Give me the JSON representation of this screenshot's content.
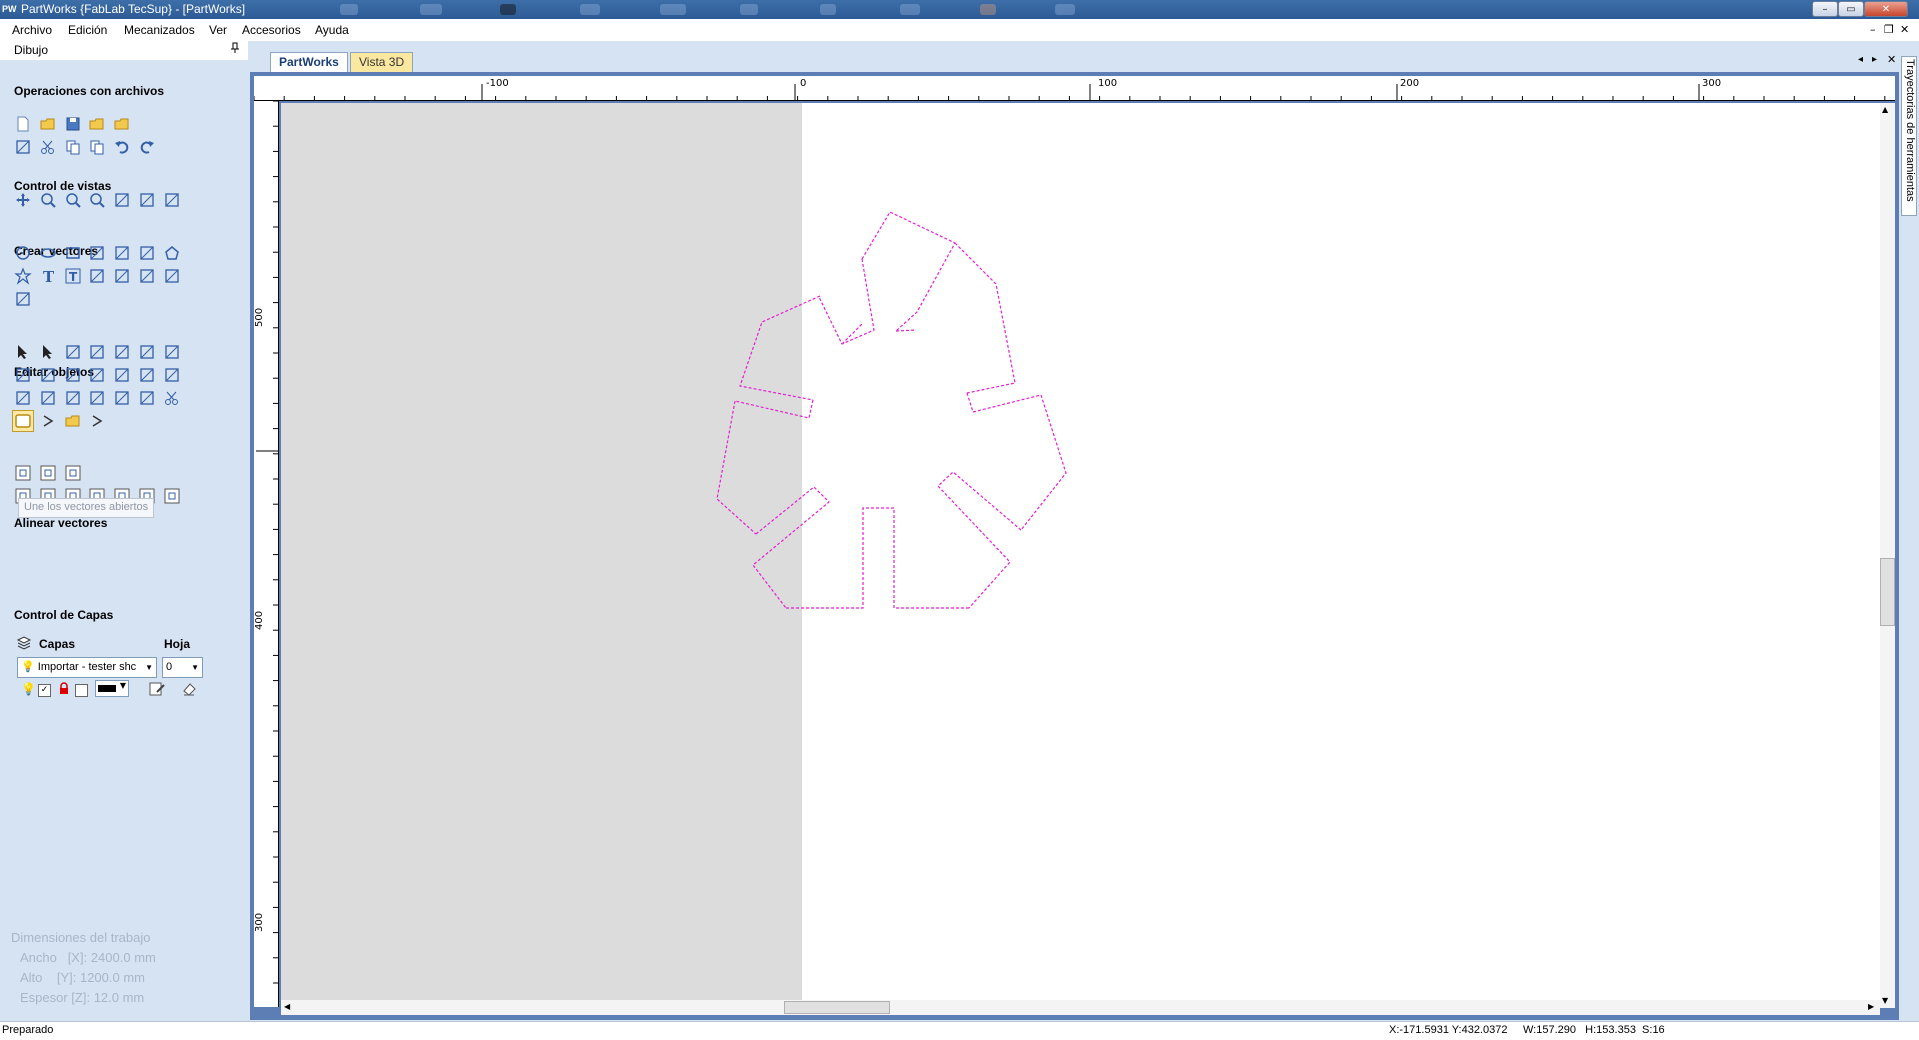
{
  "window": {
    "title": "PartWorks {FabLab TecSup} - [PartWorks]",
    "logo_text": "PW",
    "buttons": {
      "minimize": "–",
      "restore": "▭",
      "close": "✕"
    }
  },
  "menubar": {
    "items": [
      "Archivo",
      "Edición",
      "Mecanizados",
      "Ver",
      "Accesorios",
      "Ayuda"
    ],
    "mdi_controls": {
      "minimize": "–",
      "restore": "❐",
      "close": "✕"
    }
  },
  "panel": {
    "title": "Dibujo",
    "pin_icon": "pin-icon",
    "sections": {
      "archivos": "Operaciones con archivos",
      "vistas": "Control de vistas",
      "vectores": "Crear vectores",
      "editar": "Editar objetos",
      "alinear": "Alinear vectores",
      "capas": "Control de Capas"
    },
    "tooltip": "Une los vectores abiertos",
    "layers": {
      "capas_label": "Capas",
      "hoja_label": "Hoja",
      "layer_value": "Importar - tester shc",
      "sheet_value": "0"
    },
    "job": {
      "title": "Dimensiones del trabajo",
      "ancho": "Ancho   [X]: 2400.0 mm",
      "alto": "Alto    [Y]: 1200.0 mm",
      "espesor": "Espesor [Z]: 12.0 mm"
    }
  },
  "tabs": {
    "partworks": "PartWorks",
    "vista3d": "Vista 3D"
  },
  "right_tab": {
    "label": "Trayectorias de herramientas"
  },
  "ruler": {
    "top_labels": [
      "-100",
      "0",
      "100",
      "200",
      "300"
    ],
    "left_labels": [
      "500",
      "400",
      "300"
    ]
  },
  "status": {
    "state": "Preparado",
    "coords": "X:-171.5931 Y:432.0372",
    "size": "W:157.290   H:153.353  S:16"
  },
  "colors": {
    "accent": "#5d7eb4",
    "panel_bg": "#d6e3f3",
    "vector_color": "#e61fd2"
  }
}
